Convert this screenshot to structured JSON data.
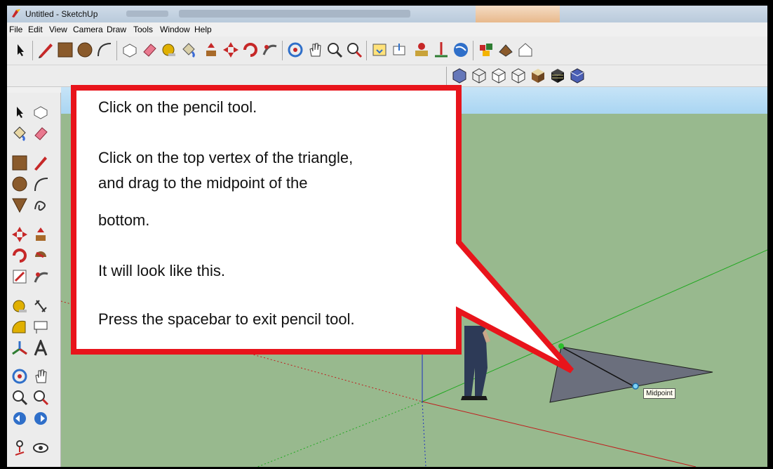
{
  "window": {
    "title": "Untitled - SketchUp"
  },
  "menu": [
    "File",
    "Edit",
    "View",
    "Camera",
    "Draw",
    "Tools",
    "Window",
    "Help"
  ],
  "toolbar": {
    "row1_icons": [
      "select-icon",
      "pencil-icon",
      "rectangle-icon",
      "circle-icon",
      "arc-icon",
      "make-component-icon",
      "paint-bucket-icon",
      "tape-measure-icon",
      "paint-icon",
      "push-pull-icon",
      "move-icon",
      "rotate-icon",
      "follow-me-icon",
      "orbit-icon",
      "pan-icon",
      "zoom-icon",
      "zoom-extents-icon",
      "get-models-icon",
      "share-model-icon",
      "add-location-icon",
      "toggle-terrain-icon",
      "google-earth-icon",
      "components-icon",
      "model-info-icon",
      "house-icon"
    ],
    "row2_icons": [
      "xray-style-icon",
      "wireframe-style-icon",
      "hidden-line-style-icon",
      "shaded-style-icon",
      "shaded-textures-style-icon",
      "monochrome-style-icon",
      "back-edges-style-icon"
    ]
  },
  "callout": {
    "lines": [
      "Click on the pencil tool.",
      "Click on the top vertex of the triangle,",
      "and drag to the midpoint of the",
      "bottom.",
      "It will look like this.",
      "Press the spacebar to exit pencil tool."
    ]
  },
  "tooltip": {
    "midpoint": "Midpoint"
  },
  "colors": {
    "callout_border": "#e8141b",
    "ground": "#98b98e",
    "sky": "#a9d5f2",
    "triangle": "#6b6f7d"
  }
}
